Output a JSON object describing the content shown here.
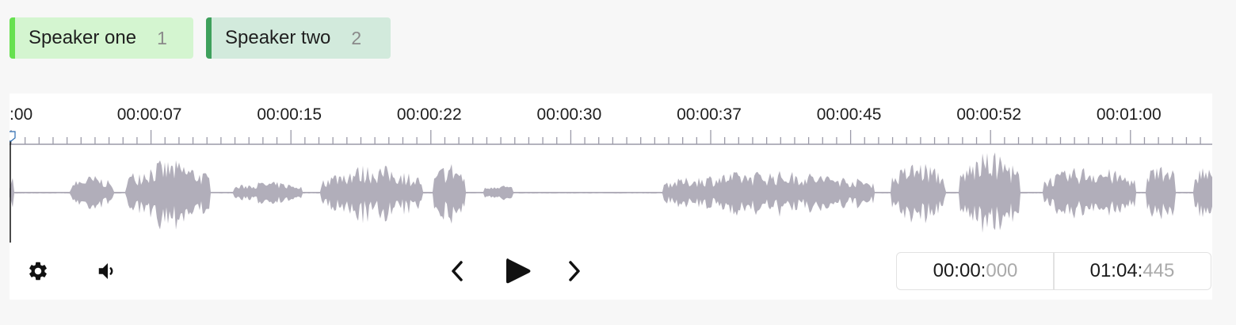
{
  "labels": [
    {
      "name": "Speaker one",
      "hotkey": "1",
      "color": "#66e14f",
      "background": "#d4f5d0"
    },
    {
      "name": "Speaker two",
      "hotkey": "2",
      "color": "#3ea05c",
      "background": "#d2eadc"
    }
  ],
  "timeline": {
    "tick_labels": [
      ":00",
      "00:00:07",
      "00:00:15",
      "00:00:22",
      "00:00:30",
      "00:00:37",
      "00:00:45",
      "00:00:52",
      "00:01:00"
    ],
    "waveform_color": "#b1aeba",
    "axis_color": "#9b9aa8"
  },
  "controls": {
    "settings_icon": "gear-icon",
    "volume_icon": "volume-icon",
    "prev_icon": "chevron-left-icon",
    "play_icon": "play-icon",
    "next_icon": "chevron-right-icon"
  },
  "time": {
    "current_main": "00:00:",
    "current_ms": "000",
    "duration_main": "01:04:",
    "duration_ms": "445"
  }
}
